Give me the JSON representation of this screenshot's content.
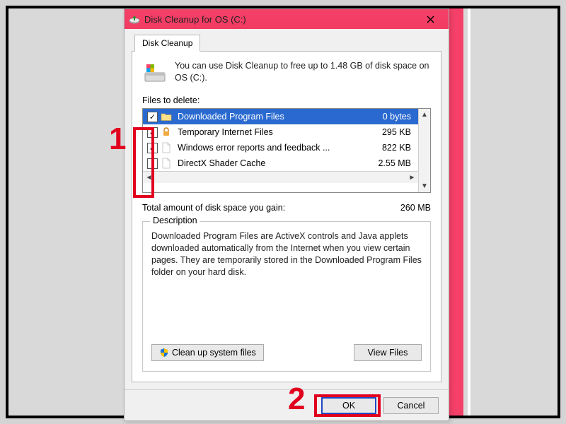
{
  "titlebar": {
    "title": "Disk Cleanup for OS (C:)"
  },
  "tab_label": "Disk Cleanup",
  "intro": "You can use Disk Cleanup to free up to 1.48 GB of disk space on OS (C:).",
  "files_label": "Files to delete:",
  "files": [
    {
      "checked": true,
      "name": "Downloaded Program Files",
      "size": "0 bytes",
      "selected": true,
      "icon": "folder"
    },
    {
      "checked": true,
      "name": "Temporary Internet Files",
      "size": "295 KB",
      "selected": false,
      "icon": "lock"
    },
    {
      "checked": true,
      "name": "Windows error reports and feedback ...",
      "size": "822 KB",
      "selected": false,
      "icon": "file"
    },
    {
      "checked": false,
      "name": "DirectX Shader Cache",
      "size": "2.55 MB",
      "selected": false,
      "icon": "file"
    }
  ],
  "total": {
    "label": "Total amount of disk space you gain:",
    "value": "260 MB"
  },
  "description": {
    "heading": "Description",
    "text": "Downloaded Program Files are ActiveX controls and Java applets downloaded automatically from the Internet when you view certain pages. They are temporarily stored in the Downloaded Program Files folder on your hard disk."
  },
  "buttons": {
    "cleanup_system": "Clean up system files",
    "view_files": "View Files",
    "ok": "OK",
    "cancel": "Cancel"
  },
  "annotations": {
    "one": "1",
    "two": "2"
  }
}
